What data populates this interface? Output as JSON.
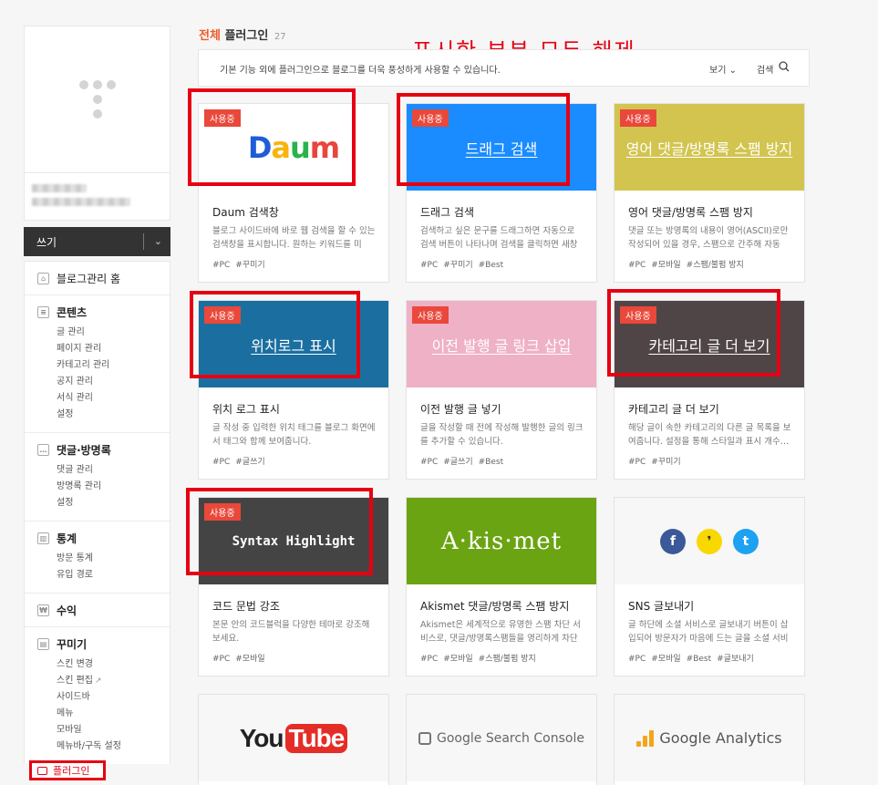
{
  "sidebar": {
    "write_label": "쓰기",
    "menu": {
      "home": "블로그관리 홈",
      "contents": {
        "title": "콘텐츠",
        "items": [
          "글 관리",
          "페이지 관리",
          "카테고리 관리",
          "공지 관리",
          "서식 관리",
          "설정"
        ]
      },
      "comments": {
        "title": "댓글·방명록",
        "items": [
          "댓글 관리",
          "방명록 관리",
          "설정"
        ]
      },
      "stats": {
        "title": "통계",
        "items": [
          "방문 통계",
          "유입 경로"
        ]
      },
      "revenue": "수익",
      "decorate": {
        "title": "꾸미기",
        "items": [
          "스킨 변경",
          "스킨 편집",
          "사이드바",
          "메뉴",
          "모바일",
          "메뉴바/구독 설정"
        ]
      },
      "plugin": "플러그인"
    }
  },
  "header": {
    "title_accent": "전체",
    "title": "플러그인",
    "count": "27",
    "annotation": "표시한 부분 모두 해제",
    "description": "기본 기능 외에 플러그인으로 블로그를 더욱 풍성하게 사용할 수 있습니다.",
    "view_label": "보기",
    "search_label": "검색"
  },
  "badge_label": "사용중",
  "cards": [
    {
      "title": "Daum 검색창",
      "desc": "블로그 사이드바에 바로 웹 검색을 할 수 있는 검색창을 표시합니다. 원하는 키워드를 미리…",
      "tags": [
        "#PC",
        "#꾸미기"
      ]
    },
    {
      "thumb": "드래그 검색",
      "title": "드래그 검색",
      "desc": "검색하고 싶은 문구를 드래그하면 자동으로 검색 버튼이 나타나며 검색을 클릭하면 새창으…",
      "tags": [
        "#PC",
        "#꾸미기",
        "#Best"
      ]
    },
    {
      "thumb": "영어 댓글/방명록 스팸 방지",
      "title": "영어 댓글/방명록 스팸 방지",
      "desc": "댓글 또는 방명록의 내용이 영어(ASCII)로만 작성되어 있을 경우, 스팸으로 간주해 자동으…",
      "tags": [
        "#PC",
        "#모바일",
        "#스팸/불펌 방지"
      ]
    },
    {
      "thumb": "위치로그 표시",
      "title": "위치 로그 표시",
      "desc": "글 작성 중 입력한 위치 태그를 블로그 화면에서 태그와 함께 보여줍니다.",
      "tags": [
        "#PC",
        "#글쓰기"
      ]
    },
    {
      "thumb": "이전 발행 글 링크 삽입",
      "title": "이전 발행 글 넣기",
      "desc": "글을 작성할 때 전에 작성해 발행한 글의 링크를 추가할 수 있습니다.",
      "tags": [
        "#PC",
        "#글쓰기",
        "#Best"
      ]
    },
    {
      "thumb": "카테고리 글 더 보기",
      "title": "카테고리 글 더 보기",
      "desc": "해당 글이 속한 카테고리의 다른 글 목록을 보여줍니다. 설정을 통해 스타일과 표시 개수…",
      "tags": [
        "#PC",
        "#꾸미기"
      ]
    },
    {
      "thumb": "Syntax Highlight",
      "title": "코드 문법 강조",
      "desc": "본문 안의 코드블럭을 다양한 테마로 강조해보세요.",
      "tags": [
        "#PC",
        "#모바일"
      ]
    },
    {
      "thumb": "A·kis·met",
      "title": "Akismet 댓글/방명록 스팸 방지",
      "desc": "Akismet은 세계적으로 유명한 스팸 차단 서비스로, 댓글/방명록스팸들을 영리하게 차단해…",
      "tags": [
        "#PC",
        "#모바일",
        "#스팸/불펌 방지"
      ]
    },
    {
      "title": "SNS 글보내기",
      "desc": "글 하단에 소셜 서비스로 글보내기 버튼이 삽입되어 방문자가 마음에 드는 글을 소셜 서비스…",
      "tags": [
        "#PC",
        "#모바일",
        "#Best",
        "#글보내기"
      ]
    }
  ],
  "logos": {
    "daum": [
      "D",
      "a",
      "u",
      "m"
    ],
    "youtube_you": "You",
    "youtube_tube": "Tube",
    "gsc": "Google Search Console",
    "ga": "Google Analytics",
    "sns": [
      "f",
      "❜",
      "t"
    ]
  },
  "colors": {
    "accent": "#f05a28",
    "badge": "#e9483b",
    "highlight": "#e60012",
    "drag_thumb": "#1a8cff",
    "spam_thumb": "#d2c44e",
    "location_thumb": "#1b6fa0",
    "prev_thumb": "#efb1c6",
    "category_thumb": "#4f4546",
    "syntax_thumb": "#444444",
    "akismet_thumb": "#6aa412"
  }
}
